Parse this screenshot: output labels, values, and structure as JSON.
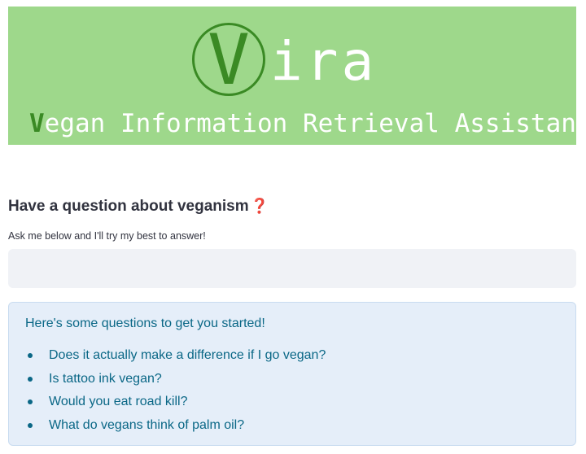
{
  "banner": {
    "logo_letter": "V",
    "logo_rest": "ira",
    "tagline_initial": "V",
    "tagline_rest": "egan Information Retrieval Assistant"
  },
  "question": {
    "title": "Have a question about veganism",
    "title_icon": "❓",
    "subtitle": "Ask me below and I'll try my best to answer!",
    "input_value": "",
    "input_placeholder": ""
  },
  "suggestions": {
    "heading": "Here's some questions to get you started!",
    "items": [
      "Does it actually make a difference if I go vegan?",
      "Is tattoo ink vegan?",
      "Would you eat road kill?",
      "What do vegans think of palm oil?"
    ]
  },
  "colors": {
    "banner_bg": "#9ed88b",
    "logo_green": "#3a8a24",
    "info_bg": "#e5eef9",
    "info_text": "#0a6786",
    "input_bg": "#f0f2f6"
  }
}
